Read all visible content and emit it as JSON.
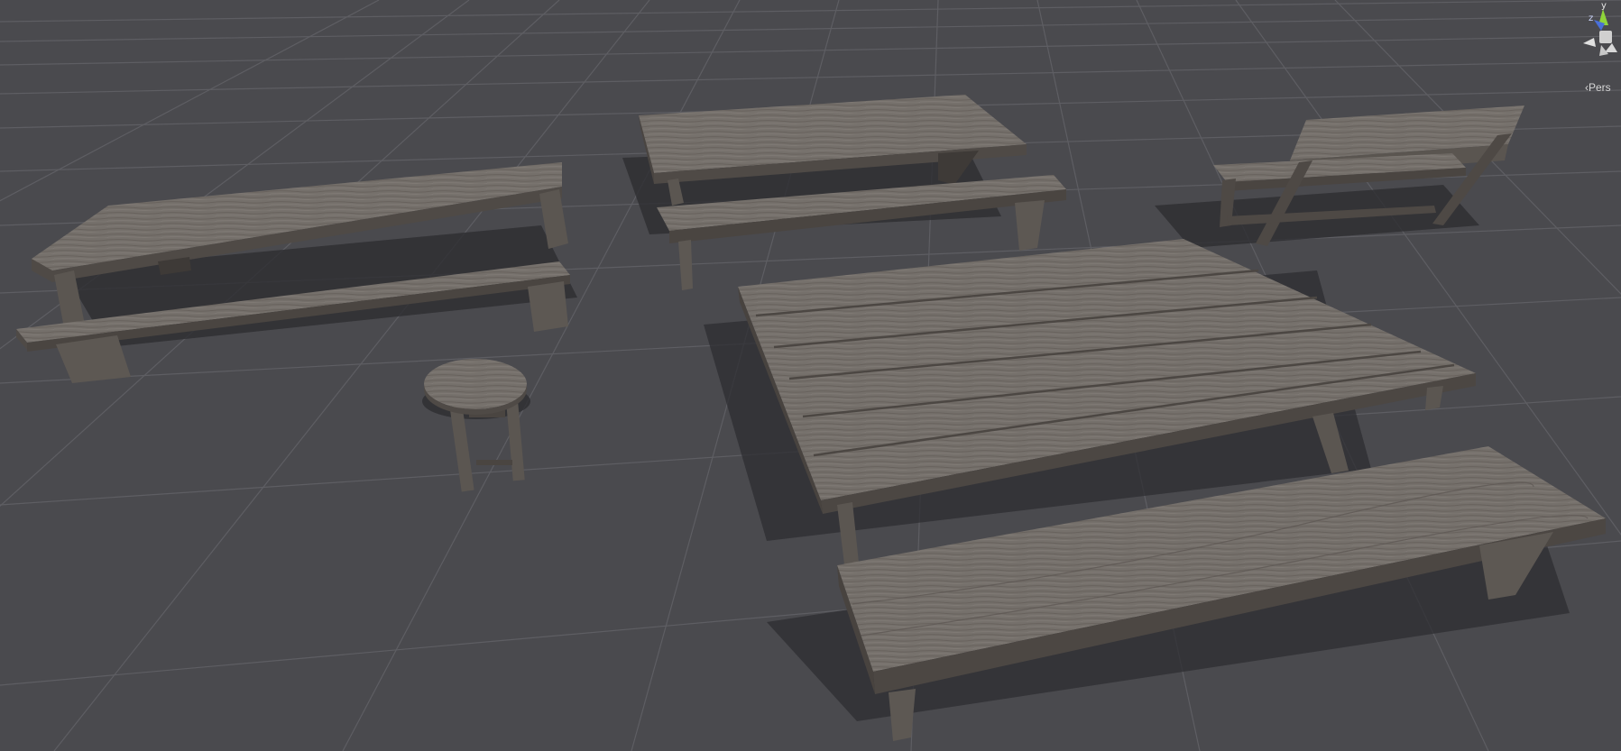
{
  "scene": {
    "background": "#4a4a4e",
    "grid_color": "#5e5e63",
    "wood_top": "#77716c",
    "wood_side": "#55504b",
    "wood_dark": "#3a3633",
    "shadow": "#2b2b2e"
  },
  "objects": [
    {
      "name": "picnic-table-left",
      "kind": "table"
    },
    {
      "name": "bench-left",
      "kind": "bench"
    },
    {
      "name": "picnic-table-back",
      "kind": "table"
    },
    {
      "name": "bench-back",
      "kind": "bench"
    },
    {
      "name": "park-bench-right",
      "kind": "bench-with-backrest"
    },
    {
      "name": "round-stool",
      "kind": "stool"
    },
    {
      "name": "picnic-table-large",
      "kind": "table"
    },
    {
      "name": "bench-front",
      "kind": "bench"
    }
  ],
  "gizmo": {
    "axis_y": "y",
    "axis_z": "z",
    "projection_label": "‹Pers",
    "y_color": "#8fd43a",
    "x_color": "#e0e0e0",
    "z_color": "#4a6fd8"
  }
}
